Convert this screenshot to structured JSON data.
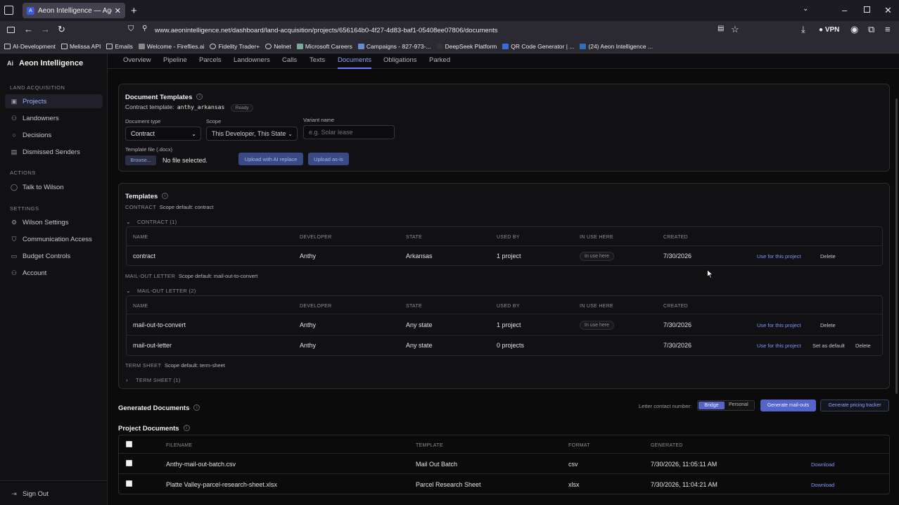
{
  "browser": {
    "tab_title": "Aeon Intelligence — Agentic AI",
    "url": "www.aeonintelligence.net/dashboard/land-acquisition/projects/656164b0-4f27-4d83-baf1-05408ee07806/documents",
    "vpn_label": "VPN",
    "bookmarks": [
      "AI-Development",
      "Melissa API",
      "Emails",
      "Welcome - Fireflies.ai",
      "Fidelity Trader+",
      "Nelnet",
      "Microsoft Careers",
      "Campaigns - 827-973-...",
      "DeepSeek Platform",
      "QR Code Generator | ...",
      "(24) Aeon Intelligence ..."
    ]
  },
  "sidebar": {
    "brand": "Aeon Intelligence",
    "brand_mark": "Ai",
    "sections": [
      {
        "title": "LAND ACQUISITION",
        "items": [
          "Projects",
          "Landowners",
          "Decisions",
          "Dismissed Senders"
        ]
      },
      {
        "title": "ACTIONS",
        "items": [
          "Talk to Wilson"
        ]
      },
      {
        "title": "SETTINGS",
        "items": [
          "Wilson Settings",
          "Communication Access",
          "Budget Controls",
          "Account"
        ]
      }
    ],
    "sign_out": "Sign Out"
  },
  "subnav": [
    "Overview",
    "Pipeline",
    "Parcels",
    "Landowners",
    "Calls",
    "Texts",
    "Documents",
    "Obligations",
    "Parked"
  ],
  "doc_templates": {
    "title": "Document Templates",
    "contract_template_label": "Contract template:",
    "contract_template_value": "anthy_arkansas",
    "status": "Ready",
    "doc_type_label": "Document type",
    "doc_type_value": "Contract",
    "scope_label": "Scope",
    "scope_value": "This Developer, This State",
    "variant_label": "Variant name",
    "variant_placeholder": "e.g. Solar lease",
    "file_label": "Template file (.docx)",
    "browse": "Browse...",
    "no_file": "No file selected.",
    "upload_ai": "Upload with AI replace",
    "upload_asis": "Upload as-is"
  },
  "templates": {
    "title": "Templates",
    "columns": [
      "NAME",
      "DEVELOPER",
      "STATE",
      "USED BY",
      "IN USE HERE",
      "CREATED"
    ],
    "groups": [
      {
        "cat": "CONTRACT",
        "scope": "Scope default: contract",
        "header": "CONTRACT",
        "count": "(1)",
        "rows": [
          {
            "name": "contract",
            "developer": "Anthy",
            "state": "Arkansas",
            "used_by": "1 project",
            "in_use": "In use here",
            "created": "7/30/2026",
            "use": "Use for this project",
            "set_default": "",
            "delete": "Delete"
          }
        ]
      },
      {
        "cat": "MAIL-OUT LETTER",
        "scope": "Scope default: mail-out-to-convert",
        "header": "MAIL-OUT LETTER",
        "count": "(2)",
        "rows": [
          {
            "name": "mail-out-to-convert",
            "developer": "Anthy",
            "state": "Any state",
            "used_by": "1 project",
            "in_use": "In use here",
            "created": "7/30/2026",
            "use": "Use for this project",
            "set_default": "",
            "delete": "Delete"
          },
          {
            "name": "mail-out-letter",
            "developer": "Anthy",
            "state": "Any state",
            "used_by": "0 projects",
            "in_use": "",
            "created": "7/30/2026",
            "use": "Use for this project",
            "set_default": "Set as default",
            "delete": "Delete"
          }
        ]
      },
      {
        "cat": "TERM SHEET",
        "scope": "Scope default: term-sheet",
        "header": "TERM SHEET",
        "count": "(1)",
        "rows": []
      }
    ]
  },
  "generated": {
    "title": "Generated Documents",
    "letter_label": "Letter contact number:",
    "opt_bridge": "Bridge",
    "opt_personal": "Personal",
    "gen_mailouts": "Generate mail-outs",
    "gen_pricing": "Generate pricing tracker"
  },
  "project_docs": {
    "title": "Project Documents",
    "columns": [
      "FILENAME",
      "TEMPLATE",
      "FORMAT",
      "GENERATED"
    ],
    "rows": [
      {
        "filename": "Anthy-mail-out-batch.csv",
        "template": "Mail Out Batch",
        "format": "csv",
        "generated": "7/30/2026, 11:05:11 AM",
        "action": "Download"
      },
      {
        "filename": "Platte Valley-parcel-research-sheet.xlsx",
        "template": "Parcel Research Sheet",
        "format": "xlsx",
        "generated": "7/30/2026, 11:04:21 AM",
        "action": "Download"
      }
    ]
  },
  "colors": {
    "accent": "#6b7cff",
    "link": "#7e97ff",
    "bg": "#0b0b0c"
  }
}
